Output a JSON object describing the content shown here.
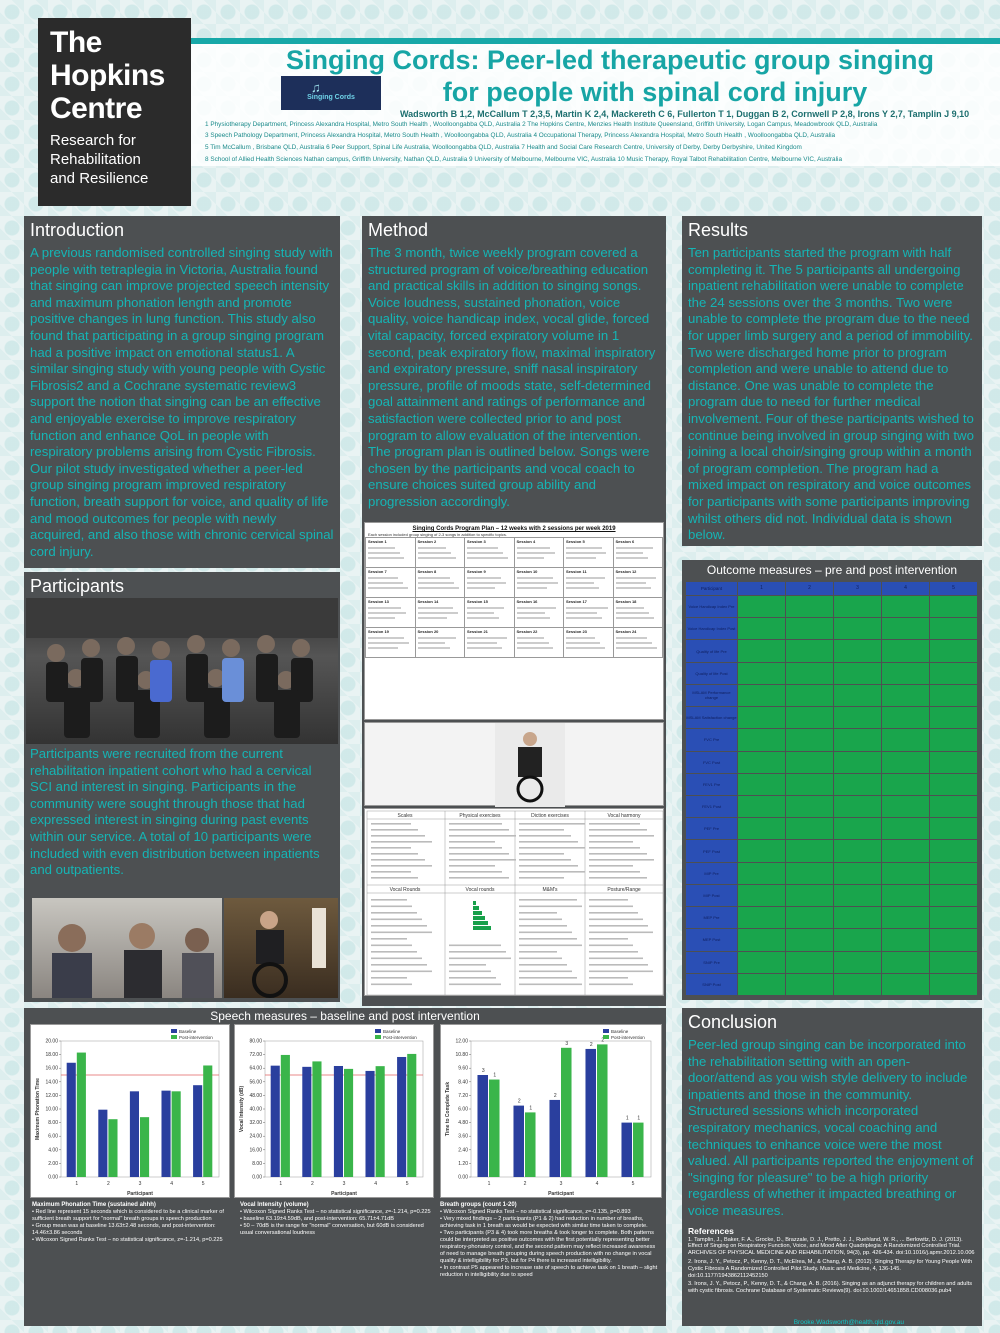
{
  "logo": {
    "line1": "The",
    "line2": "Hopkins",
    "line3": "Centre",
    "tagline1": "Research for",
    "tagline2": "Rehabilitation",
    "tagline3": "and Resilience"
  },
  "title": {
    "line1": "Singing Cords: Peer-led therapeutic group singing",
    "line2": "for people with spinal cord injury",
    "logo_text": "Singing Cords",
    "authors": "Wadsworth B 1,2, McCallum T 2,3,5, Martin K 2,4, Mackereth C 6, Fullerton T 1, Duggan B 2, Cornwell P 2,8, Irons Y 2,7, Tamplin J 9,10",
    "affiliations": [
      "1 Physiotherapy Department, Princess Alexandra Hospital, Metro South Health , Woolloongabba QLD, Australia 2 The Hopkins Centre, Menzies Health Institute Queensland, Griffith University, Logan Campus, Meadowbrook QLD, Australia",
      "3 Speech Pathology Department, Princess Alexandra Hospital, Metro South Health , Woolloongabba QLD, Australia 4 Occupational Therapy, Princess Alexandra Hospital, Metro South Health , Woolloongabba QLD, Australia",
      "5 Tim McCallum , Brisbane QLD, Australia 6 Peer Support, Spinal Life Australia, Woolloongabba QLD, Australia 7 Health and Social Care Research Centre, University of Derby, Derby Derbyshire, United Kingdom",
      "8 School of Allied Health Sciences Nathan campus, Griffith University, Nathan QLD, Australia 9 University of Melbourne, Melbourne VIC, Australia 10 Music Therapy, Royal Talbot Rehabilitation Centre, Melbourne VIC, Australia"
    ]
  },
  "introduction": {
    "heading": "Introduction",
    "body": "A previous randomised controlled singing study with people with tetraplegia in Victoria, Australia found that singing can improve projected speech intensity and maximum phonation length and promote positive changes in lung function. This study also found that participating in a group singing program had a positive impact on emotional status1. A similar singing study with young people with Cystic Fibrosis2 and a Cochrane systematic review3 support the notion that singing can be an effective and enjoyable exercise to improve respiratory function and enhance QoL in people with respiratory problems arising from Cystic Fibrosis. Our pilot study investigated whether a peer-led group singing program improved respiratory function, breath support for voice, and quality of life and mood outcomes for people with newly acquired, and also those with chronic cervical spinal cord injury."
  },
  "participants": {
    "heading": "Participants",
    "body": "Participants were recruited from the current rehabilitation inpatient cohort who had a cervical SCI and interest in singing. Participants in the community were sought through those that had expressed interest in singing during past events within our service. A total of 10 participants were included with even distribution between inpatients and outpatients."
  },
  "method": {
    "heading": "Method",
    "body": "The 3 month, twice weekly program covered a structured program of voice/breathing education and practical skills in addition to singing songs. Voice loudness, sustained phonation, voice quality, voice handicap index, vocal glide, forced vital capacity, forced expiratory volume in 1 second, peak expiratory flow, maximal inspiratory and expiratory pressure, sniff nasal inspiratory pressure, profile of moods state, self-determined goal attainment and ratings of performance and satisfaction were collected prior to and post program to allow evaluation of the intervention. The program plan is outlined below. Songs were chosen by the participants and vocal coach to ensure choices suited group ability and progression accordingly.",
    "plan_title": "Singing Cords Program Plan – 12 weeks with 2 sessions per week 2019",
    "plan_sub": "Each session included group singing of 2-3 songs in addition to specific topics.",
    "sessions": [
      "Session 1",
      "Session 2",
      "Session 3",
      "Session 4",
      "Session 5",
      "Session 6",
      "Session 7",
      "Session 8",
      "Session 9",
      "Session 10",
      "Session 11",
      "Session 12",
      "Session 13",
      "Session 14",
      "Session 15",
      "Session 16",
      "Session 17",
      "Session 18",
      "Session 19",
      "Session 20",
      "Session 21",
      "Session 22",
      "Session 23",
      "Session 24"
    ],
    "exercise_headers": [
      "Scales",
      "Physical exercises",
      "Diction exercises",
      "Vocal harmony"
    ],
    "exercise_headers2": [
      "Vocal Rounds",
      "Vocal rounds",
      "M&M's",
      "Posture/Range"
    ]
  },
  "results": {
    "heading": "Results",
    "body": "Ten participants started the program with half completing it. The 5 participants all undergoing inpatient rehabilitation were unable to complete the 24 sessions over the 3 months. Two were unable to complete the program due to the need for upper limb surgery and a period of immobility. Two were discharged home prior to program completion and were unable to attend due to distance. One was unable to complete the program due to need for further medical involvement. Four of these participants wished to continue being involved in group singing with two joining a local choir/singing group within a month of program completion. The program had a mixed impact on respiratory and voice outcomes for participants with some participants improving whilst others did not. Individual data is shown below.",
    "outcome_title": "Outcome measures – pre and post intervention",
    "outcome_header": [
      "Participant",
      "1",
      "2",
      "3",
      "4",
      "5"
    ],
    "outcome_rows": [
      "Voice Handicap Index Pre",
      "Voice Handicap Index Post",
      "Quality of life Pre",
      "Quality of life Post",
      "MSLAM Performance change",
      "MSLAM Satisfaction change",
      "FVC Pre",
      "FVC Post",
      "FEV1 Pre",
      "FEV1 Post",
      "PEF Pre",
      "PEF Post",
      "MIP Pre",
      "MIP Post",
      "MEP Pre",
      "MEP Post",
      "SNIP Pre",
      "SNIP Post"
    ]
  },
  "speech": {
    "heading": "Speech measures – baseline and post intervention",
    "legend_baseline": "Baseline",
    "legend_post": "Post-intervention",
    "xlabel": "Participant",
    "colors": {
      "baseline": "#2a3f9e",
      "post": "#3ab54a",
      "threshold": "#e06060"
    }
  },
  "chart_data": [
    {
      "type": "bar",
      "ylabel": "Maximum Phonation Time",
      "xlabel": "Participant",
      "categories": [
        "1",
        "2",
        "3",
        "4",
        "5"
      ],
      "ylim": [
        0,
        20
      ],
      "series": [
        {
          "name": "Baseline",
          "values": [
            16.8,
            9.9,
            12.6,
            12.7,
            13.5
          ]
        },
        {
          "name": "Post-intervention",
          "values": [
            18.3,
            8.5,
            8.8,
            12.6,
            16.4
          ]
        }
      ],
      "threshold": 15
    },
    {
      "type": "bar",
      "ylabel": "Vocal Intensity (dB)",
      "xlabel": "Participant",
      "categories": [
        "1",
        "2",
        "3",
        "4",
        "5"
      ],
      "ylim": [
        0,
        80
      ],
      "series": [
        {
          "name": "Baseline",
          "values": [
            65.5,
            64.8,
            65.3,
            62.4,
            70.6
          ]
        },
        {
          "name": "Post-intervention",
          "values": [
            71.8,
            68.0,
            63.6,
            65.2,
            72.4
          ]
        }
      ],
      "threshold": 60
    },
    {
      "type": "bar",
      "ylabel": "Time to Complete Task",
      "xlabel": "Participant",
      "categories": [
        "1",
        "2",
        "3",
        "4",
        "5"
      ],
      "ylim": [
        0,
        12
      ],
      "series": [
        {
          "name": "Baseline",
          "values": [
            9.0,
            6.3,
            6.8,
            11.3,
            4.8
          ]
        },
        {
          "name": "Post-intervention",
          "values": [
            8.6,
            5.7,
            11.4,
            11.7,
            4.8
          ]
        }
      ],
      "labels_baseline": [
        "3",
        "2",
        "2",
        "2",
        "1"
      ],
      "labels_post": [
        "1",
        "1",
        "3",
        "2",
        "1"
      ]
    }
  ],
  "speech_captions": [
    {
      "title": "Maximum Phonation Time (sustained ahhh)",
      "items": [
        "Red line represent 15 seconds which is considered to be a clinical marker of sufficient breath support for \"normal\" breath groups in speech production",
        "Group mean was at baseline 13.63±2.48 seconds, and post-intervention: 14.46±3.86 seconds",
        "Wilcoxon Signed Ranks Test – no statistical significance, z=-1.214, p=0.225"
      ]
    },
    {
      "title": "Vocal Intensity (volume)",
      "items": [
        "Wilcoxon Signed Ranks Test – no statistical significance, z=-1.214, p=0.225",
        "baseline 63.19±4.59dB, and post-intervention: 65.71±4.71dB",
        "50 – 70dB is the range for \"normal\" conversation, but 60dB is considered usual conversational loudness"
      ]
    },
    {
      "title": "Breath groups (count 1-20)",
      "items": [
        "Wilcoxon Signed Ranks Test – no statistical significance, z=-0.135, p=0.893",
        "Very mixed findings – 2 participants (P1 & 2) had reduction in number of breaths, achieving task in 1 breath as would be expected with similar time taken to complete.",
        "Two participants (P3 & 4) took more breaths & took longer to complete. Both patterns could be interpreted as positive outcomes with the first potentially representing better respiratory-phonatory control, and the second pattern may reflect increased awareness of need to manage breath grouping during speech production with no change in vocal quality & intelligibility for P3, but for P4 there is increased intelligibility.",
        "In contrast P5 appeared to increase rate of speech to achieve task on 1 breath – slight reduction in intelligibility due to speed"
      ]
    }
  ],
  "conclusion": {
    "heading": "Conclusion",
    "body": "Peer-led group singing can be incorporated into the rehabilitation setting with an open-door/attend as you wish style delivery to include inpatients and those in the community. Structured sessions which incorporated respiratory mechanics, vocal coaching and techniques to enhance voice were the most valued. All participants reported the enjoyment of \"singing for pleasure\" to be a high priority regardless of whether it impacted breathing or voice measures.",
    "references_heading": "References",
    "references": [
      "1. Tamplin, J., Baker, F. A., Grocke, D., Brazzale, D. J., Pretto, J. J., Ruehland, W. R., ... Berlowitz, D. J. (2013). Effect of Singing on Respiratory Function, Voice, and Mood After Quadriplegia: A Randomized Controlled Trial. ARCHIVES OF PHYSICAL MEDICINE AND REHABILITATION, 94(3), pp. 426-434. doi:10.1016/j.apmr.2012.10.006",
      "2. Irons, J. Y., Petocz, P., Kenny, D. T., McElrea, M., & Chang, A. B. (2012). Singing Therapy for Young People With Cystic Fibrosis A Randomized Controlled Pilot Study. Music and Medicine, 4, 136-145. doi:10.1177/1943862112452150",
      "3. Irons, J. Y., Petocz, P., Kenny, D. T., & Chang, A. B. (2016). Singing as an adjunct therapy for children and adults with cystic fibrosis. Cochrane Database of Systematic Reviews(9). doi:10.1002/14651858.CD008036.pub4"
    ],
    "email": "Brooke.Wadsworth@health.qld.gov.au"
  }
}
